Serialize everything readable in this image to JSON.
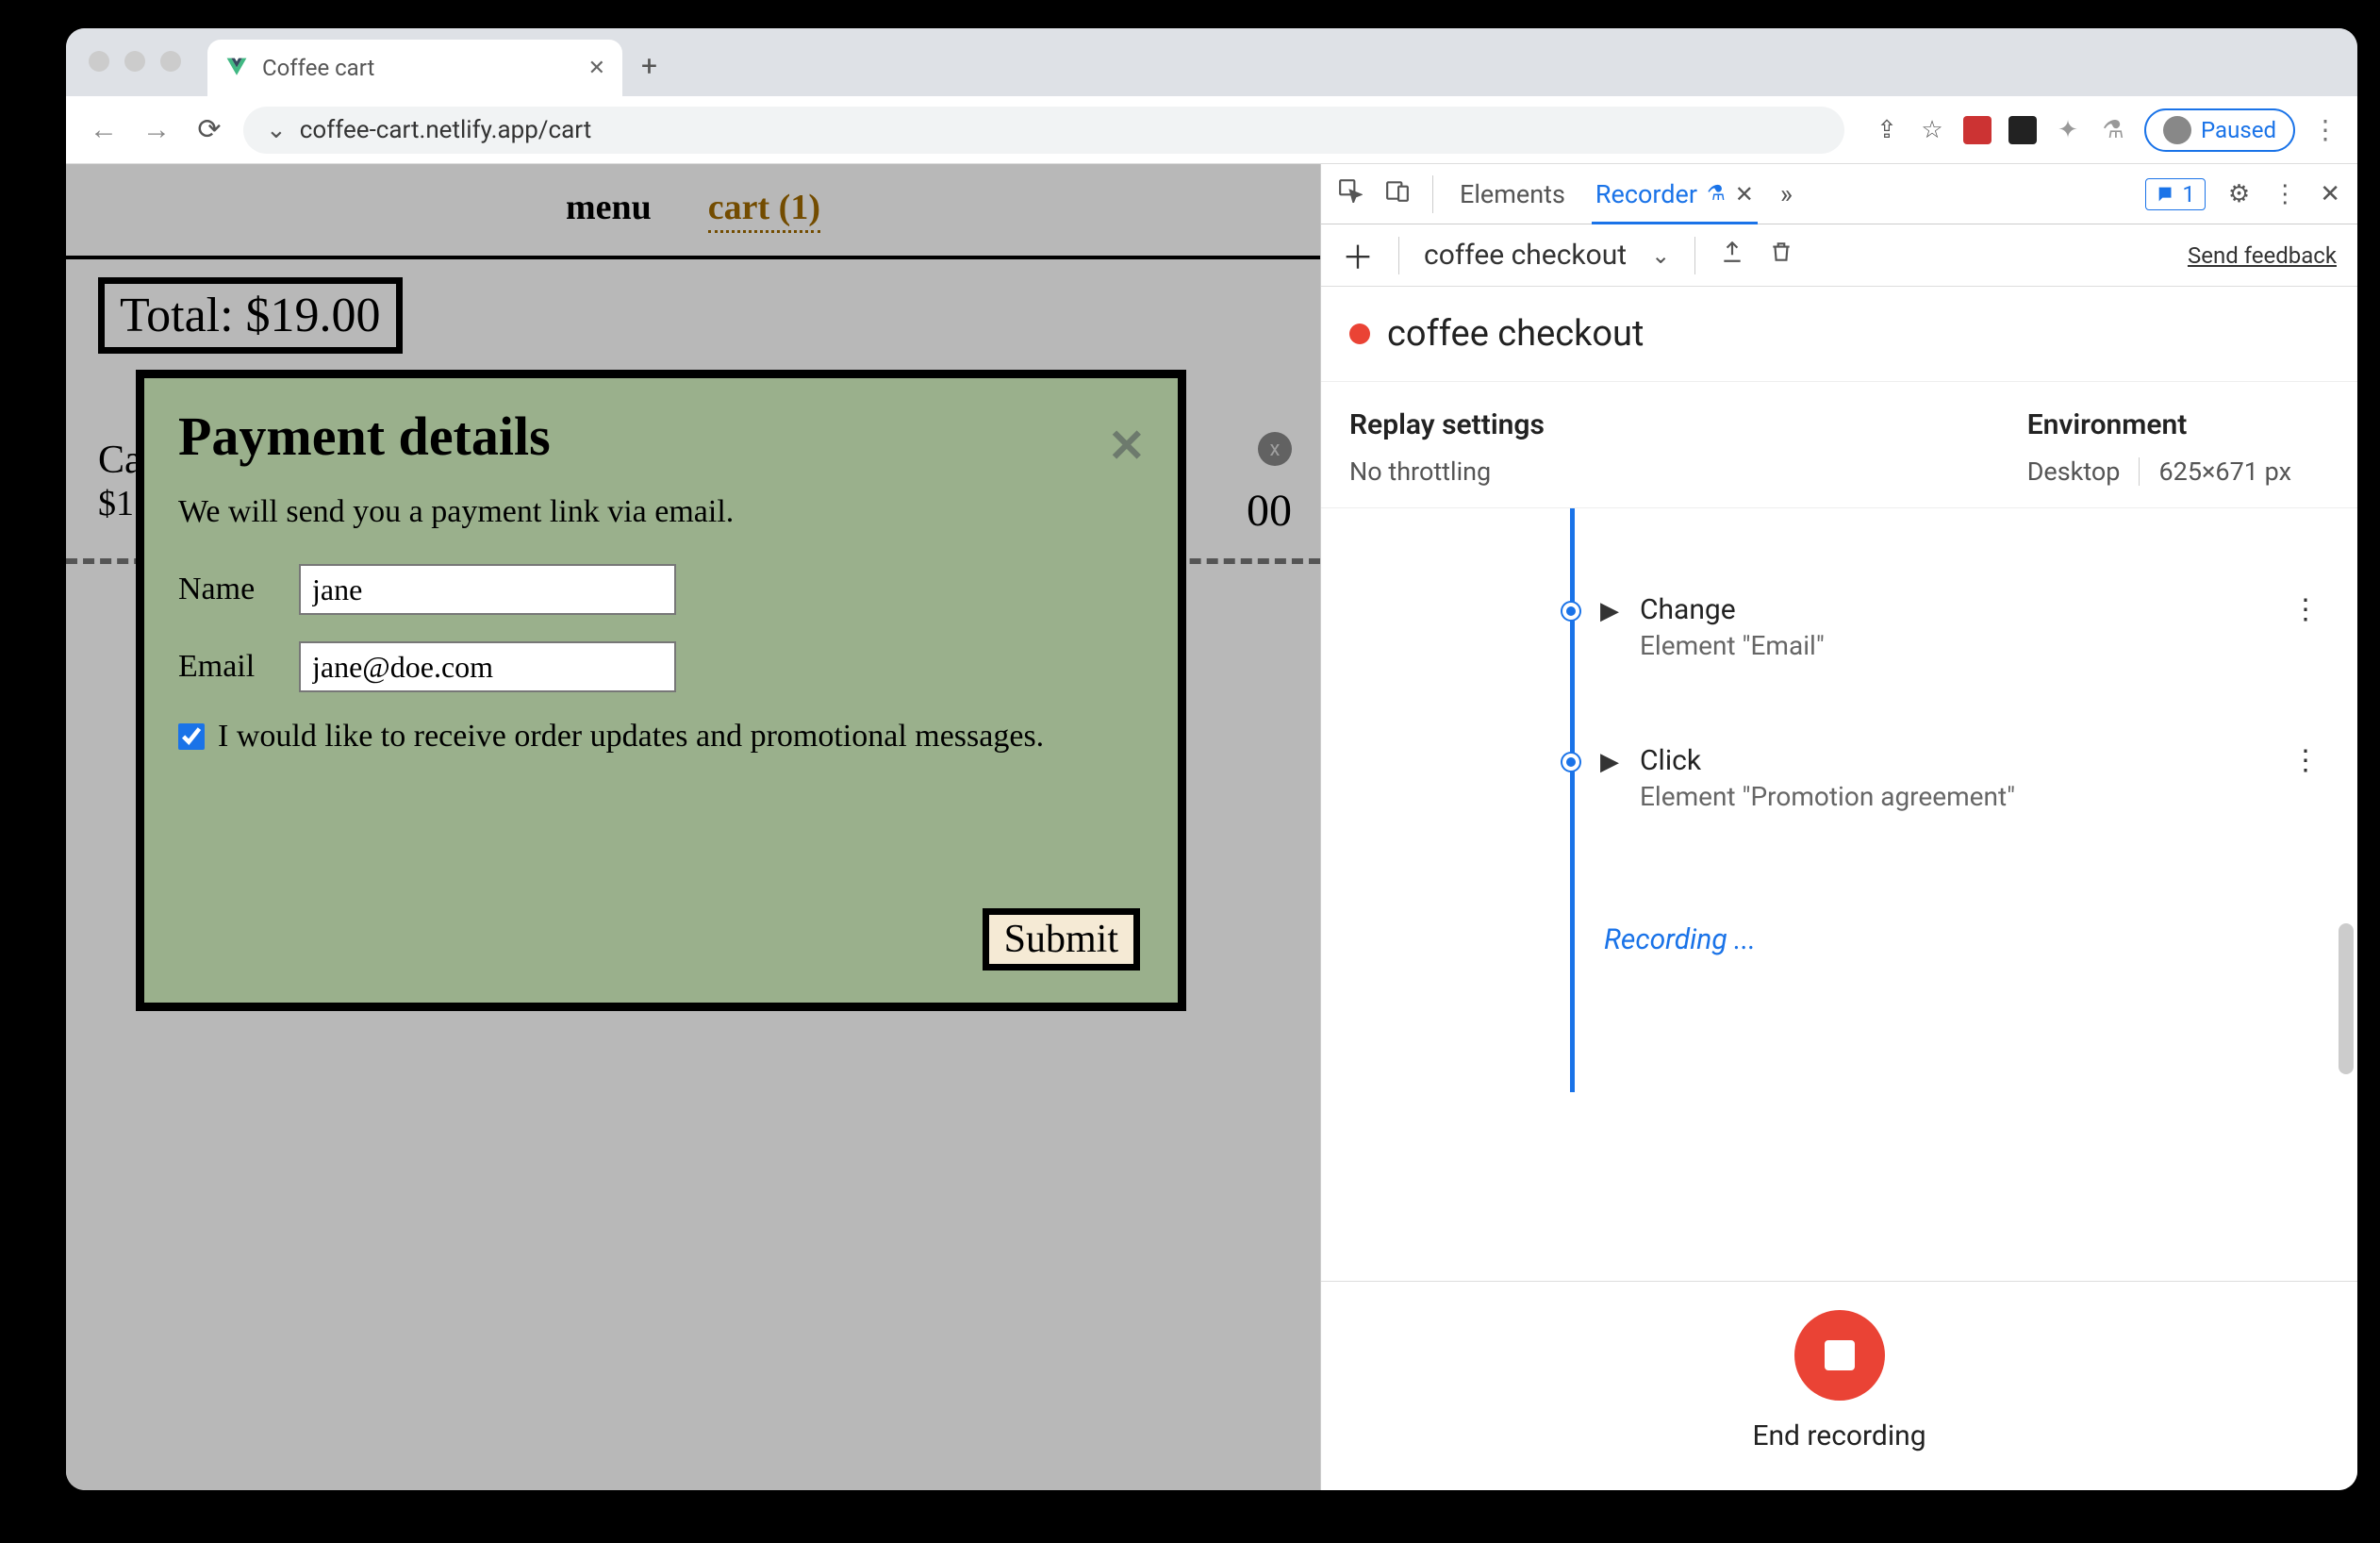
{
  "browser": {
    "tab_title": "Coffee cart",
    "url": "coffee-cart.netlify.app/cart",
    "paused_label": "Paused"
  },
  "page": {
    "nav": {
      "menu": "menu",
      "cart": "cart (1)"
    },
    "total_label": "Total: $19.00",
    "obscured_item_prefix": "Ca",
    "obscured_item_price_prefix": "$1",
    "obscured_right_price_suffix": "00",
    "obscured_close": "x"
  },
  "modal": {
    "title": "Payment details",
    "subtitle": "We will send you a payment link via email.",
    "name_label": "Name",
    "name_value": "jane",
    "email_label": "Email",
    "email_value": "jane@doe.com",
    "promo_label": "I would like to receive order updates and promotional messages.",
    "promo_checked": true,
    "submit": "Submit"
  },
  "devtools": {
    "tabs": {
      "elements": "Elements",
      "recorder": "Recorder"
    },
    "issues_badge": "1",
    "toolbar": {
      "recording_name": "coffee checkout",
      "feedback": "Send feedback"
    },
    "header_title": "coffee checkout",
    "settings": {
      "replay_heading": "Replay settings",
      "replay_value": "No throttling",
      "env_heading": "Environment",
      "env_device": "Desktop",
      "env_dims": "625×671 px"
    },
    "steps": [
      {
        "title": "Change",
        "subtitle": "Element \"Email\""
      },
      {
        "title": "Click",
        "subtitle": "Element \"Promotion agreement\""
      }
    ],
    "recording_text": "Recording ...",
    "end_label": "End recording"
  }
}
